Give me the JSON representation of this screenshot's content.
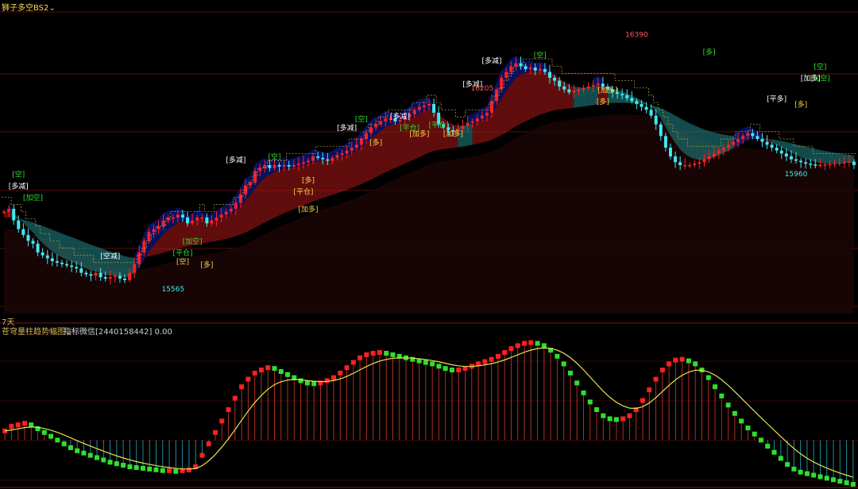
{
  "main_panel": {
    "title": "狮子多空BS2",
    "period": "7天"
  },
  "sub_panel": {
    "title": "苍穹量柱趋势幅图",
    "info": "指标微信[2440158442] 0.00"
  },
  "colors": {
    "up": "#ff2020",
    "down": "#40e8f0",
    "ribbon_bull": "#b01818",
    "ribbon_bear": "#208a8a",
    "body_fill": "#0a1470",
    "osc_up": "#ff2020",
    "osc_down": "#2ee02e",
    "signal": "#e8e24a"
  },
  "chart_data": [
    {
      "type": "line",
      "name": "main",
      "ylim": [
        15450,
        16500
      ],
      "x": [
        0,
        1,
        2,
        3,
        4,
        5,
        6,
        7,
        8,
        9,
        10,
        11,
        12,
        13,
        14,
        15,
        16,
        17,
        18,
        19,
        20,
        21,
        22,
        23,
        24,
        25,
        26,
        27,
        28,
        29,
        30,
        31,
        32,
        33,
        34,
        35,
        36,
        37,
        38,
        39,
        40,
        41,
        42,
        43,
        44,
        45,
        46,
        47,
        48,
        49,
        50,
        51,
        52,
        53,
        54,
        55,
        56,
        57,
        58,
        59,
        60,
        61,
        62,
        63,
        64,
        65,
        66,
        67,
        68,
        69,
        70,
        71,
        72,
        73,
        74,
        75,
        76,
        77,
        78,
        79,
        80,
        81,
        82,
        83,
        84,
        85,
        86,
        87,
        88,
        89,
        90,
        91,
        92,
        93,
        94,
        95,
        96,
        97,
        98,
        99,
        100,
        101,
        102,
        103,
        104,
        105,
        106,
        107,
        108,
        109,
        110,
        111,
        112,
        113,
        114,
        115,
        116,
        117,
        118,
        119,
        120,
        121,
        122,
        123,
        124,
        125,
        126,
        127,
        128,
        129,
        130,
        131,
        132,
        133,
        134,
        135,
        136,
        137,
        138,
        139,
        140,
        141,
        142,
        143,
        144,
        145,
        146,
        147,
        148,
        149,
        150,
        151,
        152,
        153,
        154,
        155,
        156,
        157,
        158,
        159,
        160,
        161,
        162,
        163,
        164,
        165,
        166,
        167,
        168,
        169,
        170,
        171,
        172,
        173,
        174,
        175,
        176
      ],
      "series": [
        {
          "name": "close",
          "values": [
            15800,
            15810,
            15770,
            15740,
            15720,
            15700,
            15690,
            15660,
            15650,
            15640,
            15630,
            15625,
            15620,
            15615,
            15610,
            15605,
            15590,
            15585,
            15580,
            15590,
            15575,
            15570,
            15575,
            15580,
            15570,
            15565,
            15590,
            15620,
            15660,
            15700,
            15730,
            15740,
            15750,
            15770,
            15780,
            15780,
            15790,
            15780,
            15760,
            15770,
            15780,
            15780,
            15760,
            15770,
            15780,
            15790,
            15800,
            15810,
            15830,
            15860,
            15890,
            15900,
            15940,
            15950,
            15960,
            15950,
            15960,
            15955,
            15960,
            15955,
            15960,
            15965,
            15970,
            15975,
            15990,
            15985,
            15980,
            15975,
            15985,
            15995,
            16000,
            16010,
            16020,
            16030,
            16050,
            16070,
            16090,
            16100,
            16110,
            16120,
            16120,
            16110,
            16115,
            16125,
            16135,
            16150,
            16160,
            16165,
            16170,
            16140,
            16100,
            16090,
            16080,
            16075,
            16085,
            16095,
            16105,
            16110,
            16120,
            16130,
            16140,
            16180,
            16220,
            16260,
            16280,
            16300,
            16310,
            16300,
            16290,
            16295,
            16285,
            16290,
            16280,
            16260,
            16250,
            16230,
            16220,
            16210,
            16215,
            16220,
            16225,
            16230,
            16235,
            16240,
            16230,
            16220,
            16210,
            16205,
            16200,
            16190,
            16180,
            16170,
            16160,
            16150,
            16130,
            16100,
            16060,
            16020,
            15990,
            15970,
            15960,
            15960,
            15960,
            15965,
            15970,
            15980,
            15990,
            16000,
            16010,
            16020,
            16030,
            16040,
            16050,
            16060,
            16070,
            16060,
            16050,
            16040,
            16030,
            16020,
            16010,
            16000,
            15990,
            15980,
            15975,
            15970,
            15965,
            15962,
            15960,
            15961,
            15962,
            15964,
            15966,
            15968,
            15970,
            15972,
            15960
          ],
          "extremes": [
            {
              "label": "16390",
              "value": 16390,
              "x": 131
            },
            {
              "label": "16205",
              "value": 16205,
              "x": 99
            },
            {
              "label": "15565",
              "value": 15565,
              "x": 35
            },
            {
              "label": "15960",
              "value": 15960,
              "x": 164
            }
          ]
        }
      ],
      "annotations": [
        {
          "text": "[空]",
          "x": 3,
          "value": 15920,
          "color": "#2ee02e"
        },
        {
          "text": "[多减]",
          "x": 3,
          "value": 15880,
          "color": "#ffffff"
        },
        {
          "text": "[加空]",
          "x": 6,
          "value": 15840,
          "color": "#2ee02e"
        },
        {
          "text": "[空减]",
          "x": 22,
          "value": 15640,
          "color": "#ffffff"
        },
        {
          "text": "[加空]",
          "x": 39,
          "value": 15690,
          "color": "#2ee02e"
        },
        {
          "text": "[平仓]",
          "x": 37,
          "value": 15650,
          "color": "#2ee02e"
        },
        {
          "text": "[多]",
          "x": 42,
          "value": 15610,
          "color": "#ffd24a"
        },
        {
          "text": "[空]",
          "x": 37,
          "value": 15620,
          "color": "#ffd24a"
        },
        {
          "text": "[多减]",
          "x": 48,
          "value": 15970,
          "color": "#ffffff"
        },
        {
          "text": "[空]",
          "x": 56,
          "value": 15980,
          "color": "#2ee02e"
        },
        {
          "text": "[多]",
          "x": 63,
          "value": 15900,
          "color": "#ffd24a"
        },
        {
          "text": "[加多]",
          "x": 63,
          "value": 15800,
          "color": "#ffd24a"
        },
        {
          "text": "[平仓]",
          "x": 62,
          "value": 15860,
          "color": "#ffd24a"
        },
        {
          "text": "[多减]",
          "x": 71,
          "value": 16080,
          "color": "#ffffff"
        },
        {
          "text": "[空]",
          "x": 74,
          "value": 16110,
          "color": "#2ee02e"
        },
        {
          "text": "[多]",
          "x": 77,
          "value": 16030,
          "color": "#ffd24a"
        },
        {
          "text": "[多减]",
          "x": 82,
          "value": 16120,
          "color": "#ffffff"
        },
        {
          "text": "[平仓]",
          "x": 84,
          "value": 16080,
          "color": "#2ee02e"
        },
        {
          "text": "[加多]",
          "x": 86,
          "value": 16060,
          "color": "#ffd24a"
        },
        {
          "text": "[平仓]",
          "x": 90,
          "value": 16090,
          "color": "#2ee02e"
        },
        {
          "text": "[加多]",
          "x": 93,
          "value": 16060,
          "color": "#ffd24a"
        },
        {
          "text": "[多减]",
          "x": 97,
          "value": 16230,
          "color": "#ffffff"
        },
        {
          "text": "[多减]",
          "x": 101,
          "value": 16310,
          "color": "#ffffff"
        },
        {
          "text": "[空]",
          "x": 111,
          "value": 16330,
          "color": "#2ee02e"
        },
        {
          "text": "[加多]",
          "x": 125,
          "value": 16210,
          "color": "#ffd24a"
        },
        {
          "text": "[多]",
          "x": 124,
          "value": 16170,
          "color": "#ffd24a"
        },
        {
          "text": "[多]",
          "x": 146,
          "value": 16340,
          "color": "#2ee02e"
        },
        {
          "text": "[平多]",
          "x": 160,
          "value": 16180,
          "color": "#ffffff"
        },
        {
          "text": "[多]",
          "x": 165,
          "value": 16160,
          "color": "#ffd24a"
        },
        {
          "text": "[空]",
          "x": 169,
          "value": 16290,
          "color": "#2ee02e"
        },
        {
          "text": "[加空]",
          "x": 169,
          "value": 16250,
          "color": "#2ee02e"
        },
        {
          "text": "[加多]",
          "x": 167,
          "value": 16250,
          "color": "#ffffff"
        }
      ]
    },
    {
      "type": "bar",
      "name": "oscillator",
      "ylim": [
        -60,
        140
      ],
      "values": [
        12,
        18,
        20,
        22,
        20,
        15,
        10,
        5,
        0,
        -5,
        -10,
        -14,
        -17,
        -20,
        -23,
        -26,
        -29,
        -31,
        -33,
        -35,
        -36,
        -37,
        -38,
        -39,
        -40,
        -40,
        -41,
        -40,
        -39,
        -35,
        -20,
        -5,
        10,
        25,
        40,
        55,
        70,
        80,
        88,
        92,
        95,
        94,
        90,
        86,
        82,
        78,
        75,
        74,
        75,
        78,
        82,
        88,
        95,
        102,
        108,
        112,
        114,
        115,
        114,
        112,
        110,
        108,
        106,
        104,
        102,
        100,
        97,
        94,
        92,
        92,
        94,
        97,
        100,
        103,
        106,
        110,
        115,
        120,
        124,
        127,
        128,
        127,
        124,
        118,
        110,
        100,
        88,
        75,
        62,
        50,
        40,
        32,
        28,
        27,
        28,
        32,
        40,
        52,
        66,
        80,
        92,
        100,
        105,
        106,
        104,
        100,
        92,
        82,
        70,
        58,
        46,
        35,
        25,
        16,
        8,
        0,
        -8,
        -16,
        -24,
        -32,
        -38,
        -42,
        -44,
        -46,
        -48,
        -50,
        -52,
        -54,
        -56,
        -58
      ]
    }
  ]
}
